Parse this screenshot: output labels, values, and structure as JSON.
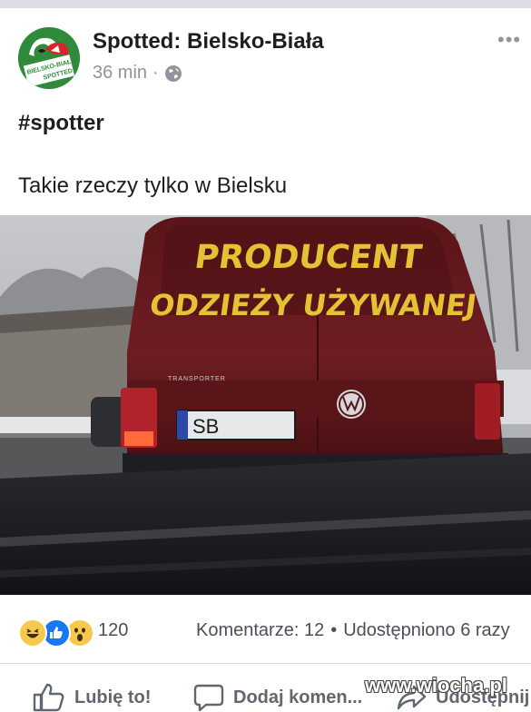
{
  "post": {
    "page_name": "Spotted: Bielsko-Biała",
    "time": "36 min",
    "separator": "·",
    "privacy_icon": "globe-icon",
    "more_icon": "more-options-icon",
    "avatar_text": [
      "BIELSKO-BIAŁA",
      "SPOTTED"
    ],
    "hashtag": "#spotter",
    "text": "Takie rzeczy tylko w Bielsku"
  },
  "photo": {
    "van_text_line1": "PRODUCENT",
    "van_text_line2": "ODZIEŻY UŻYWANEJ",
    "plate": "SB",
    "badge": "TRANSPORTER"
  },
  "stats": {
    "reactions": [
      "haha",
      "like",
      "wow"
    ],
    "reaction_count": "120",
    "comments": "Komentarze: 12",
    "separator": "•",
    "shares": "Udostępniono 6 razy"
  },
  "actions": {
    "like": "Lubię to!",
    "comment": "Dodaj komen...",
    "share": "Udostępnij"
  },
  "watermark": "www.wiocha.pl",
  "colors": {
    "van_red": "#6a1a1f",
    "lettering_yellow": "#e3c233",
    "meta_gray": "#90949c",
    "like_blue": "#1877f2",
    "haha_yellow": "#f7c94b"
  }
}
